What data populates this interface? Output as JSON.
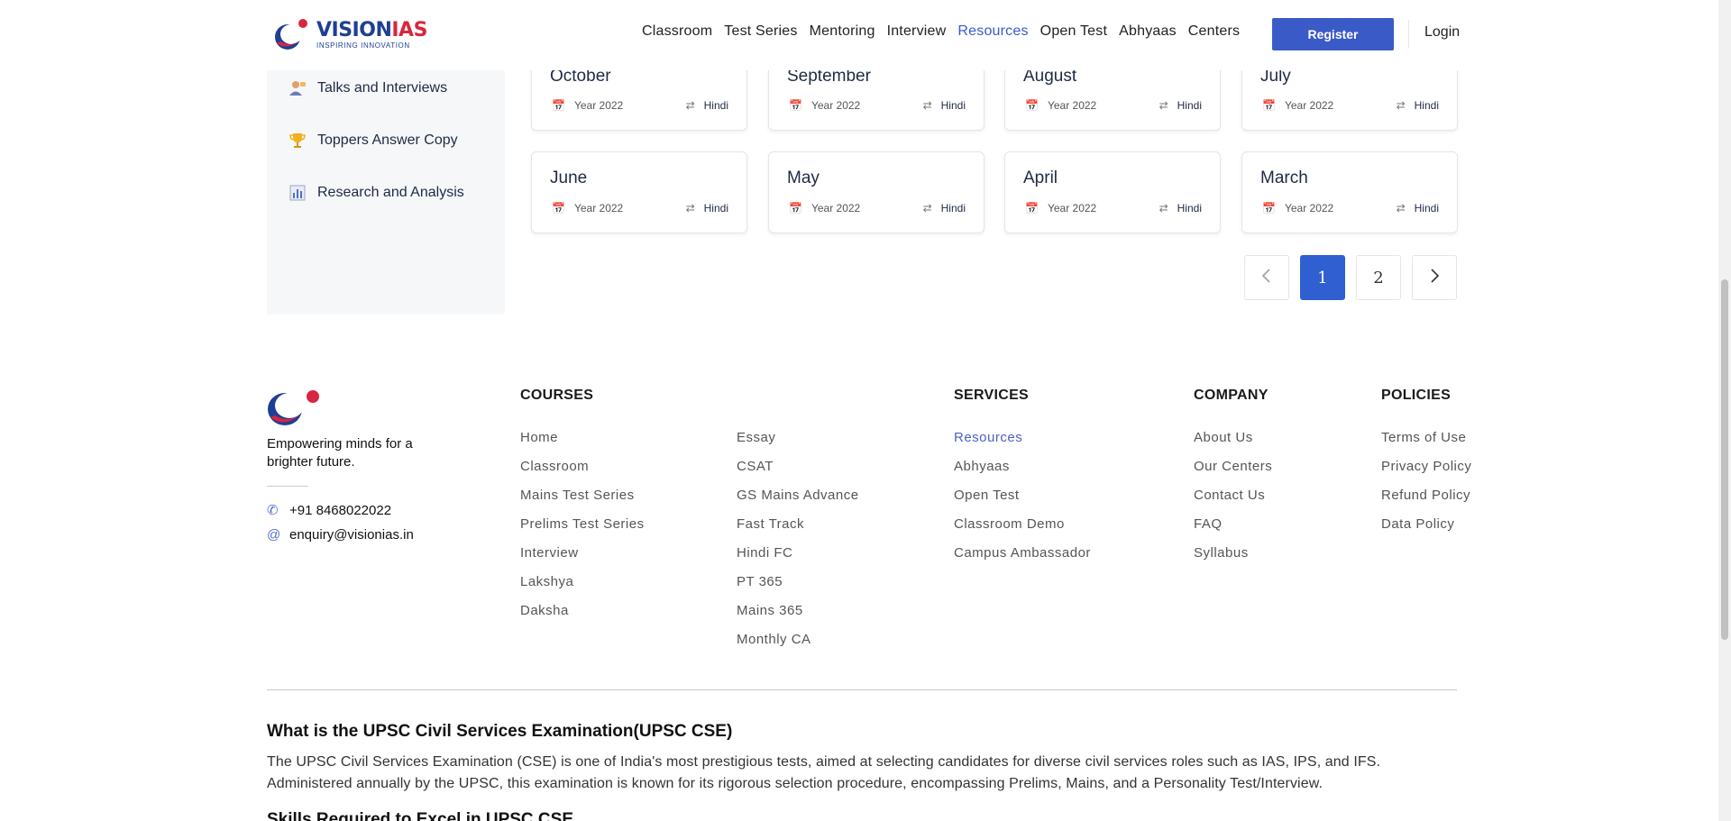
{
  "brand": {
    "name_vision": "VISION",
    "name_ias": "IAS",
    "tagline": "INSPIRING INNOVATION"
  },
  "nav": {
    "items": [
      "Classroom",
      "Test Series",
      "Mentoring",
      "Interview",
      "Resources",
      "Open Test",
      "Abhyaas",
      "Centers"
    ],
    "active": "Resources",
    "register_label": "Register",
    "login_label": "Login"
  },
  "sidebar": {
    "items": [
      {
        "label": "Talks and Interviews",
        "icon": "person-talk-icon"
      },
      {
        "label": "Toppers Answer Copy",
        "icon": "trophy-icon"
      },
      {
        "label": "Research and Analysis",
        "icon": "bar-chart-icon"
      }
    ]
  },
  "cards": [
    {
      "month": "October",
      "year": "Year 2022",
      "lang": "Hindi"
    },
    {
      "month": "September",
      "year": "Year 2022",
      "lang": "Hindi"
    },
    {
      "month": "August",
      "year": "Year 2022",
      "lang": "Hindi"
    },
    {
      "month": "July",
      "year": "Year 2022",
      "lang": "Hindi"
    },
    {
      "month": "June",
      "year": "Year 2022",
      "lang": "Hindi"
    },
    {
      "month": "May",
      "year": "Year 2022",
      "lang": "Hindi"
    },
    {
      "month": "April",
      "year": "Year 2022",
      "lang": "Hindi"
    },
    {
      "month": "March",
      "year": "Year 2022",
      "lang": "Hindi"
    }
  ],
  "pagination": {
    "prev_icon": "chevron-left-icon",
    "pages": [
      "1",
      "2"
    ],
    "current": "1",
    "next_icon": "chevron-right-icon"
  },
  "footer": {
    "tagline": "Empowering minds for a brighter future.",
    "phone": "+91 8468022022",
    "email": "enquiry@visionias.in",
    "courses_title": "COURSES",
    "courses_col1": [
      "Home",
      "Classroom",
      "Mains Test Series",
      "Prelims Test Series",
      "Interview",
      "Lakshya",
      "Daksha"
    ],
    "courses_col2": [
      "Essay",
      "CSAT",
      "GS Mains Advance",
      "Fast Track",
      "Hindi FC",
      "PT 365",
      "Mains 365",
      "Monthly CA"
    ],
    "services_title": "SERVICES",
    "services": [
      "Resources",
      "Abhyaas",
      "Open Test",
      "Classroom Demo",
      "Campus Ambassador"
    ],
    "company_title": "COMPANY",
    "company": [
      "About Us",
      "Our Centers",
      "Contact Us",
      "FAQ",
      "Syllabus"
    ],
    "policies_title": "POLICIES",
    "policies": [
      "Terms of Use",
      "Privacy Policy",
      "Refund Policy",
      "Data Policy"
    ]
  },
  "about": {
    "title": "What is the UPSC Civil Services Examination(UPSC CSE)",
    "text": "The UPSC Civil Services Examination (CSE) is one of India's most prestigious tests, aimed at selecting candidates for diverse civil services roles such as IAS, IPS, and IFS. Administered annually by the UPSC, this examination is known for its rigorous selection procedure, encompassing Prelims, Mains, and a Personality Test/Interview.",
    "next_title": "Skills Required to Excel in UPSC CSE"
  },
  "colors": {
    "accent": "#3a5bc7",
    "active_nav": "#3a59d1",
    "brand_blue": "#1f3f94",
    "brand_red": "#d7263d"
  }
}
